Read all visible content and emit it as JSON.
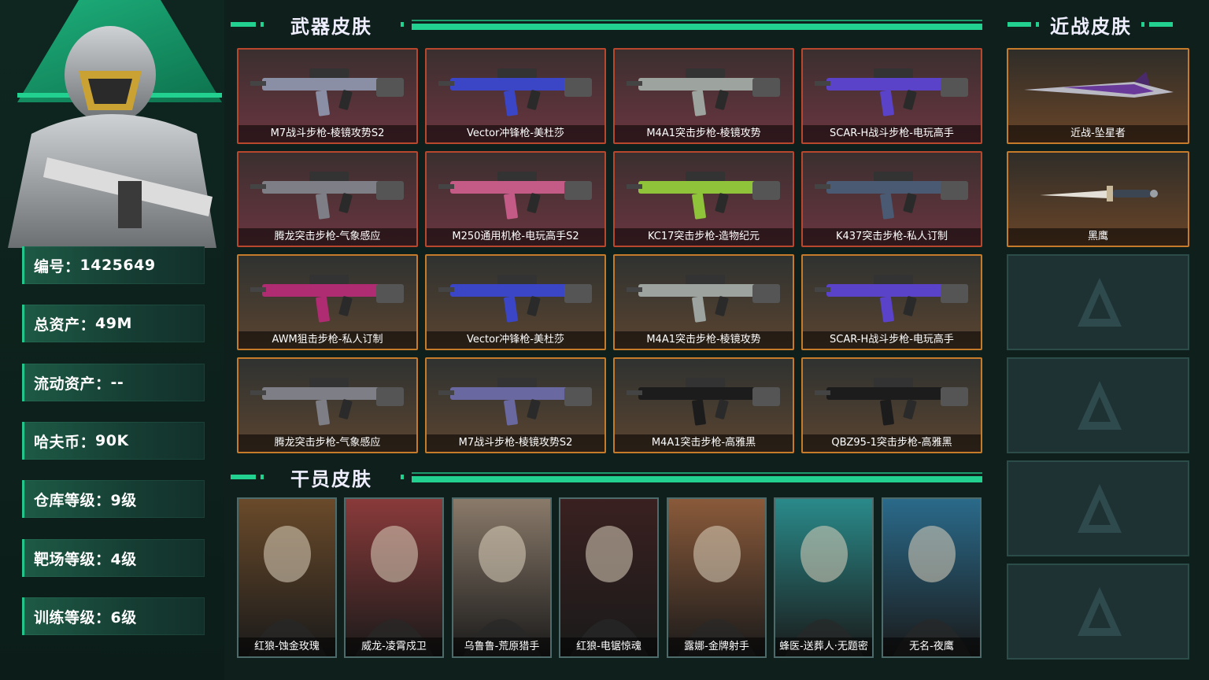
{
  "profile": {
    "stats": [
      {
        "label": "编号：",
        "value": "1425649"
      },
      {
        "label": "总资产：",
        "value": "49M"
      },
      {
        "label": "流动资产：",
        "value": "--"
      },
      {
        "label": "哈夫币：",
        "value": "90K"
      },
      {
        "label": "仓库等级：",
        "value": "9级"
      },
      {
        "label": "靶场等级：",
        "value": "4级"
      },
      {
        "label": "训练等级：",
        "value": "6级"
      }
    ]
  },
  "sections": {
    "weapon_title": "武器皮肤",
    "operator_title": "干员皮肤",
    "melee_title": "近战皮肤"
  },
  "weapons": [
    {
      "label": "M7战斗步枪-棱镜攻势S2",
      "rarity": "red",
      "color": "#8a8fa6"
    },
    {
      "label": "Vector冲锋枪-美杜莎",
      "rarity": "red",
      "color": "#3b46c7"
    },
    {
      "label": "M4A1突击步枪-棱镜攻势",
      "rarity": "red",
      "color": "#9da39e"
    },
    {
      "label": "SCAR-H战斗步枪-电玩高手",
      "rarity": "red",
      "color": "#5a42c9"
    },
    {
      "label": "腾龙突击步枪-气象感应",
      "rarity": "red",
      "color": "#7e7e86"
    },
    {
      "label": "M250通用机枪-电玩高手S2",
      "rarity": "red",
      "color": "#c45a86"
    },
    {
      "label": "KC17突击步枪-造物纪元",
      "rarity": "red",
      "color": "#8fc43a"
    },
    {
      "label": "K437突击步枪-私人订制",
      "rarity": "red",
      "color": "#4a5a72"
    },
    {
      "label": "AWM狙击步枪-私人订制",
      "rarity": "gold",
      "color": "#b02c72"
    },
    {
      "label": "Vector冲锋枪-美杜莎",
      "rarity": "gold",
      "color": "#3b46c7"
    },
    {
      "label": "M4A1突击步枪-棱镜攻势",
      "rarity": "gold",
      "color": "#9da39e"
    },
    {
      "label": "SCAR-H战斗步枪-电玩高手",
      "rarity": "gold",
      "color": "#5a42c9"
    },
    {
      "label": "腾龙突击步枪-气象感应",
      "rarity": "gold",
      "color": "#7e7e86"
    },
    {
      "label": "M7战斗步枪-棱镜攻势S2",
      "rarity": "gold",
      "color": "#6a68a0"
    },
    {
      "label": "M4A1突击步枪-高雅黑",
      "rarity": "gold",
      "color": "#1c1c1c"
    },
    {
      "label": "QBZ95-1突击步枪-高雅黑",
      "rarity": "gold",
      "color": "#1c1c1c"
    }
  ],
  "melee": [
    {
      "label": "近战-坠星者"
    },
    {
      "label": "黑鹰"
    }
  ],
  "operators": [
    {
      "label": "红狼-蚀金玫瑰",
      "color": "#6a4a2a"
    },
    {
      "label": "威龙-凌霄戍卫",
      "color": "#8a3a3a"
    },
    {
      "label": "乌鲁鲁-荒原猎手",
      "color": "#8a7a6a"
    },
    {
      "label": "红狼-电锯惊魂",
      "color": "#3a2020"
    },
    {
      "label": "露娜-金牌射手",
      "color": "#8a5a3a"
    },
    {
      "label": "蜂医-送葬人·无题密令",
      "color": "#2a8a8a"
    },
    {
      "label": "无名-夜鹰",
      "color": "#2a6a8a"
    }
  ],
  "colors": {
    "accent": "#22d08f",
    "red_border": "#b8472d",
    "gold_border": "#c67b2a"
  }
}
